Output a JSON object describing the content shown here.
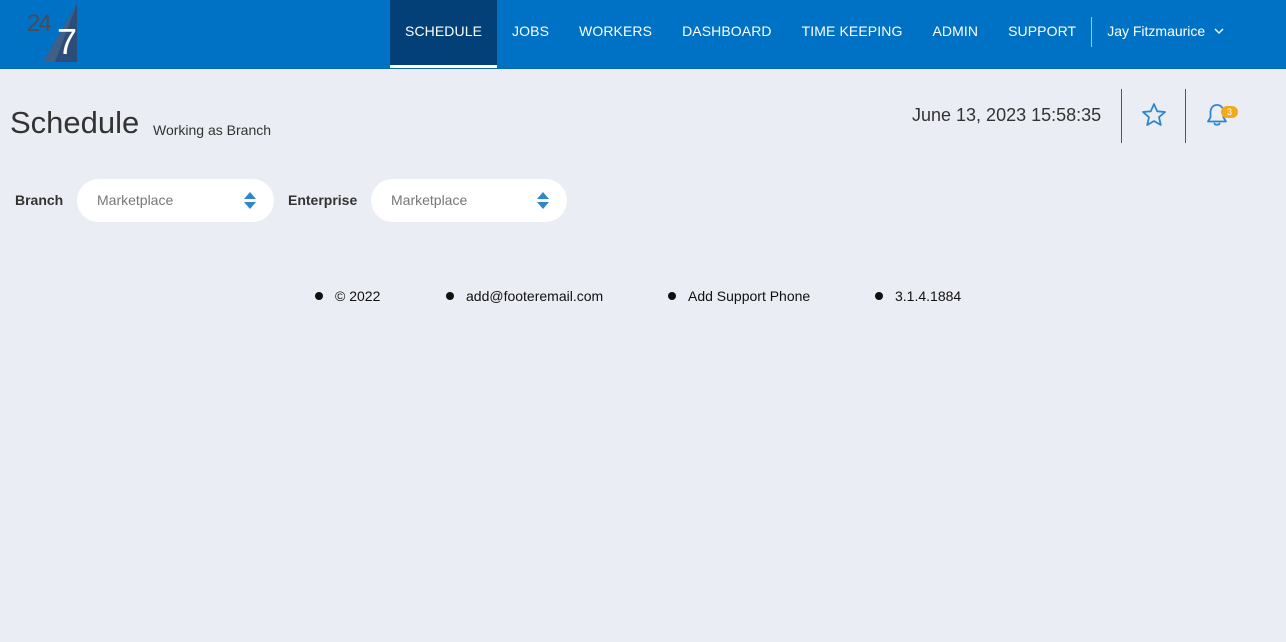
{
  "app": {
    "logo_alt": "24/7"
  },
  "nav": {
    "items": [
      {
        "label": "SCHEDULE",
        "active": true
      },
      {
        "label": "JOBS",
        "active": false
      },
      {
        "label": "WORKERS",
        "active": false
      },
      {
        "label": "DASHBOARD",
        "active": false
      },
      {
        "label": "TIME KEEPING",
        "active": false
      },
      {
        "label": "ADMIN",
        "active": false
      },
      {
        "label": "SUPPORT",
        "active": false
      }
    ],
    "user_name": "Jay Fitzmaurice"
  },
  "header": {
    "title": "Schedule",
    "subtitle": "Working as Branch",
    "datetime": "June 13, 2023 15:58:35",
    "notification_count": "3"
  },
  "filters": {
    "branch_label": "Branch",
    "branch_value": "Marketplace",
    "enterprise_label": "Enterprise",
    "enterprise_value": "Marketplace"
  },
  "footer": {
    "copyright": "© 2022",
    "email": "add@footeremail.com",
    "phone": "Add Support Phone",
    "version": "3.1.4.1884"
  },
  "colors": {
    "navbar": "#0072c6",
    "nav_active": "#034077",
    "background": "#ebedf4",
    "accent_icon": "#2f86cc",
    "badge": "#f0ab1a"
  }
}
